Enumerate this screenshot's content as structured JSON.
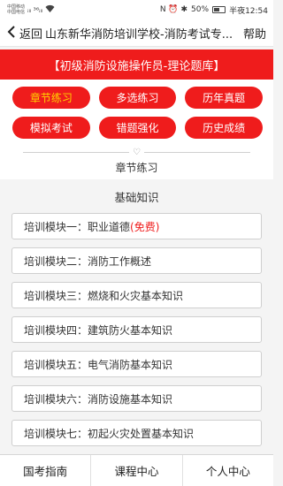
{
  "status": {
    "carrier1": "中国移动",
    "carrier2": "中国电信",
    "signal": "ᵢₗₗ ³⁶ᵢₗₗ",
    "wifi_icon": "wifi-icon",
    "right_icons": "N ⏰ ✱",
    "battery": "50%",
    "battery_level": 0.5,
    "time": "半夜12:54"
  },
  "header": {
    "back_label": "返回",
    "title": "山东新华消防培训学校-消防考试专...",
    "help_label": "帮助"
  },
  "banner": {
    "text": "【初级消防设施操作员-理论题库】"
  },
  "categories": [
    {
      "label": "章节练习"
    },
    {
      "label": "多选练习"
    },
    {
      "label": "历年真题"
    },
    {
      "label": "模拟考试"
    },
    {
      "label": "错题强化"
    },
    {
      "label": "历史成绩"
    }
  ],
  "section": {
    "title": "章节练习",
    "subtitle": "基础知识"
  },
  "modules": [
    {
      "label": "培训模块一：职业道德",
      "free": "(免费)"
    },
    {
      "label": "培训模块二：消防工作概述",
      "free": ""
    },
    {
      "label": "培训模块三：燃烧和火灾基本知识",
      "free": ""
    },
    {
      "label": "培训模块四：建筑防火基本知识",
      "free": ""
    },
    {
      "label": "培训模块五：电气消防基本知识",
      "free": ""
    },
    {
      "label": "培训模块六：消防设施基本知识",
      "free": ""
    },
    {
      "label": "培训模块七：初起火灾处置基本知识",
      "free": ""
    }
  ],
  "bottom_nav": [
    {
      "label": "国考指南"
    },
    {
      "label": "课程中心"
    },
    {
      "label": "个人中心"
    }
  ],
  "colors": {
    "brand_red": "#ef1c1c",
    "active_text": "#ffd400"
  }
}
